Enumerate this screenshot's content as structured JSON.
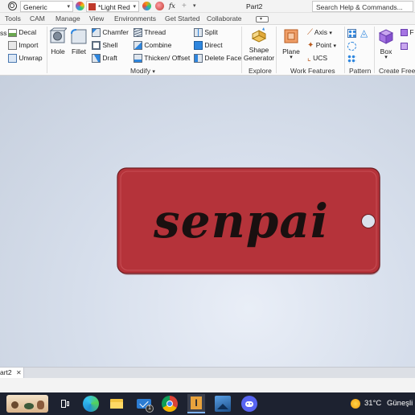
{
  "quick_access": {
    "material": "Generic",
    "appearance": "*Light Red",
    "fx_label": "fx",
    "document_title": "Part2",
    "search_placeholder": "Search Help & Commands..."
  },
  "menu_tabs": [
    "Tools",
    "CAM",
    "Manage",
    "View",
    "Environments",
    "Get Started",
    "Collaborate"
  ],
  "ribbon": {
    "partial_left_top": "ss",
    "decal": "Decal",
    "import": "Import",
    "unwrap": "Unwrap",
    "hole": "Hole",
    "fillet": "Fillet",
    "chamfer": "Chamfer",
    "shell": "Shell",
    "draft": "Draft",
    "thread": "Thread",
    "combine": "Combine",
    "thicken_offset": "Thicken/ Offset",
    "split": "Split",
    "direct": "Direct",
    "delete_face": "Delete Face",
    "modify_group": "Modify",
    "shape_generator_line1": "Shape",
    "shape_generator_line2": "Generator",
    "explore_group": "Explore",
    "plane": "Plane",
    "axis": "Axis",
    "point": "Point",
    "ucs": "UCS",
    "work_features_group": "Work Features",
    "pattern_group": "Pattern",
    "box": "Box",
    "create_freeform_group": "Create Freeform",
    "partial_right": "F"
  },
  "model": {
    "engraved_text": "senpai",
    "body_color": "#b5333a"
  },
  "doc_tabs": [
    {
      "label": "art2"
    }
  ],
  "taskbar": {
    "weather_temp": "31°C",
    "weather_desc": "Güneşli",
    "badge_count": "1"
  }
}
